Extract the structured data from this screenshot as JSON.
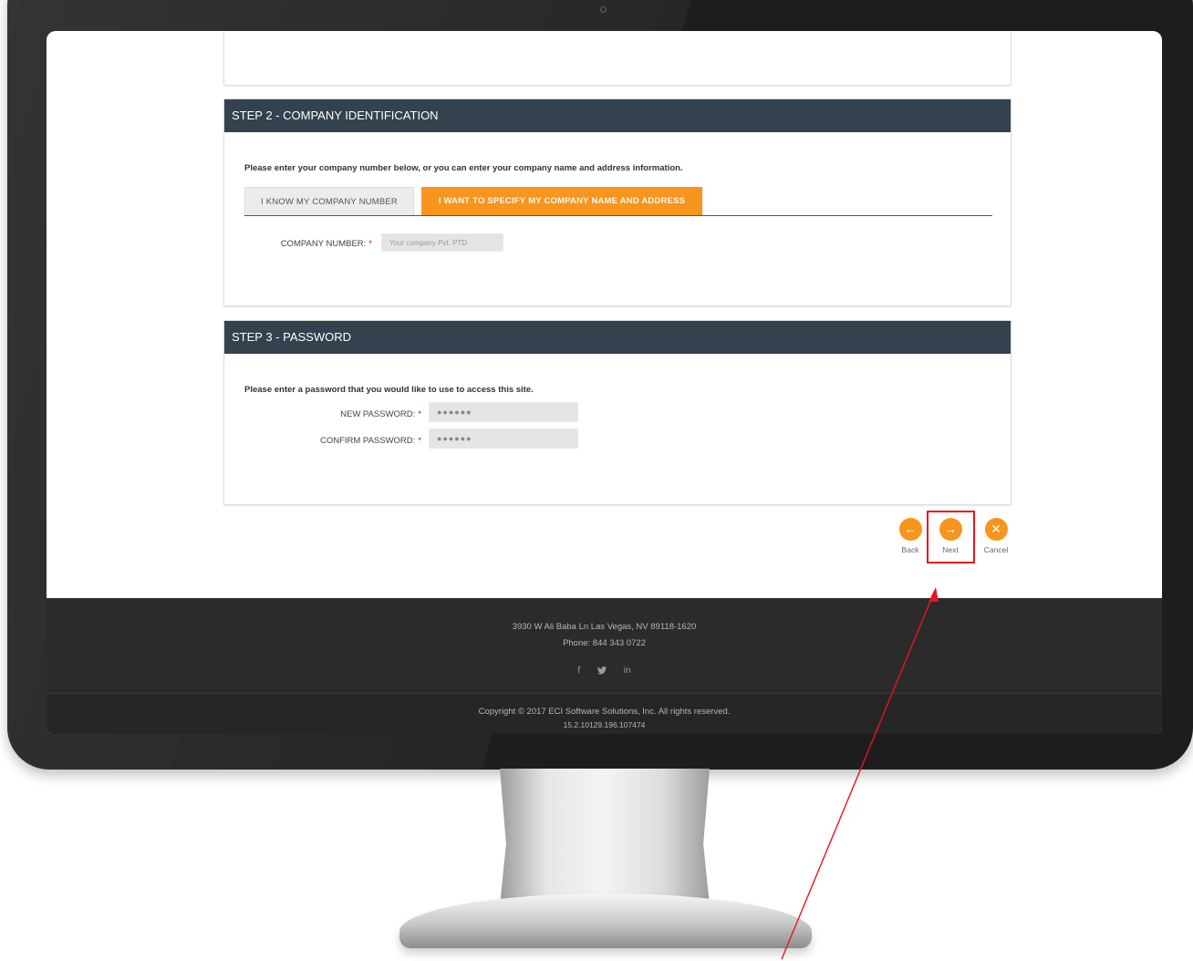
{
  "step2": {
    "header": "STEP 2 - COMPANY IDENTIFICATION",
    "instruction": "Please enter your company number below, or you can enter your company name and address information.",
    "tabs": [
      {
        "label": "I KNOW MY COMPANY NUMBER",
        "active": false
      },
      {
        "label": "I WANT TO SPECIFY MY COMPANY NAME AND ADDRESS",
        "active": true
      }
    ],
    "company_number_label": "COMPANY NUMBER:",
    "company_number_value": "Your company Pvt. PTD"
  },
  "step3": {
    "header": "STEP 3 - PASSWORD",
    "instruction": "Please enter a password that you would like to use to access this site.",
    "new_password_label": "NEW PASSWORD:",
    "new_password_value": "●●●●●●",
    "confirm_password_label": "CONFIRM PASSWORD:",
    "confirm_password_value": "●●●●●●"
  },
  "required_marker": "*",
  "actions": {
    "back_label": "Back",
    "next_label": "Next",
    "cancel_label": "Cancel"
  },
  "footer": {
    "address": "3930 W Ali Baba Ln Las Vegas, NV 89118-1620",
    "phone": "Phone: 844 343 0722",
    "social": [
      "f",
      "in"
    ],
    "copyright": "Copyright © 2017 ECI Software Solutions, Inc. All rights reserved.",
    "version": "15.2.10129.196.107474"
  },
  "colors": {
    "accent": "#f7951e",
    "header_bg": "#34414e",
    "footer_bg": "#2b2b2b",
    "highlight": "#e8141f"
  },
  "icons": {
    "back": "arrow-left-icon",
    "next": "arrow-right-icon",
    "cancel": "close-icon",
    "facebook": "facebook-icon",
    "twitter": "twitter-icon",
    "linkedin": "linkedin-icon"
  }
}
